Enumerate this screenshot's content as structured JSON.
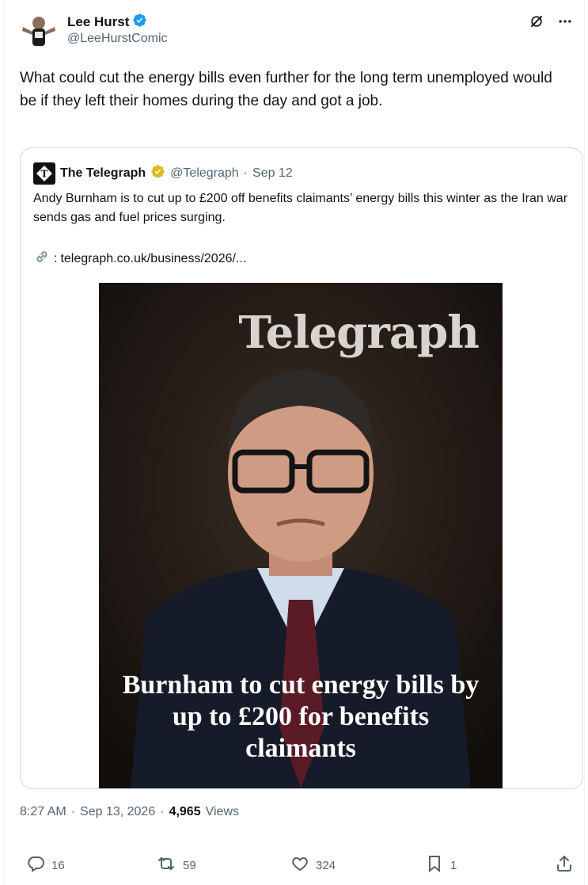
{
  "author": {
    "name": "Lee Hurst",
    "handle": "@LeeHurstComic"
  },
  "tweet": {
    "text": "What could cut the energy bills even further for the long term unemployed would be if they left their homes during the day and got a job."
  },
  "quote": {
    "name": "The Telegraph",
    "handle": "@Telegraph",
    "separator": "·",
    "date": "Sep 12",
    "text": "Andy Burnham is to cut up to £200 off benefits claimants’ energy bills this winter as the Iran war sends gas and fuel prices surging.",
    "link_prefix": ":",
    "link": "telegraph.co.uk/business/2026/...",
    "media": {
      "wordmark": "Telegraph",
      "headline": "Burnham to cut energy bills by up to £200 for benefits claimants"
    }
  },
  "meta": {
    "time": "8:27 AM",
    "sep1": "·",
    "date": "Sep 13, 2026",
    "sep2": "·",
    "views_count": "4,965",
    "views_label": "Views"
  },
  "actions": {
    "replies": "16",
    "reposts": "59",
    "likes": "324",
    "bookmarks": "1"
  },
  "colors": {
    "verified_blue": "#1d9bf0",
    "verified_gold": "#e2b719",
    "secondary_text": "#536471",
    "border": "#cfd9de"
  },
  "icons": [
    "verified-badge-icon",
    "grok-icon",
    "more-icon",
    "link-icon",
    "reply-icon",
    "repost-icon",
    "like-icon",
    "bookmark-icon",
    "share-icon"
  ]
}
